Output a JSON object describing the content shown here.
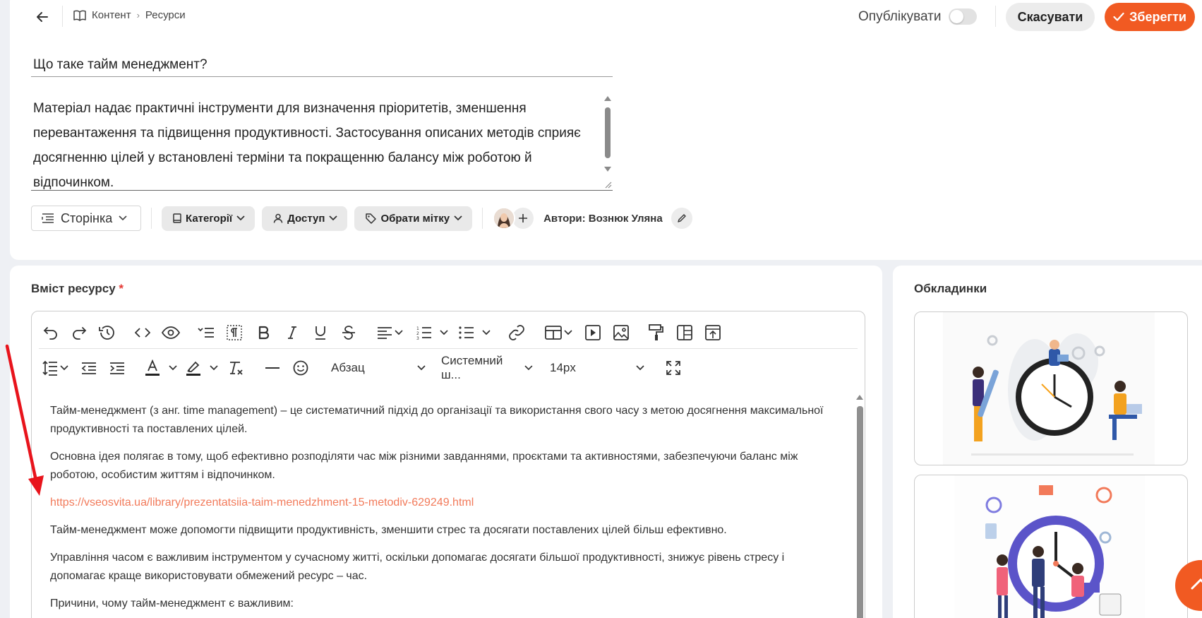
{
  "header": {
    "breadcrumb": [
      "Контент",
      "Ресурси"
    ],
    "publish_label": "Опублікувати",
    "publish_enabled": false,
    "cancel_label": "Скасувати",
    "save_label": "Зберегти"
  },
  "resource": {
    "title": "Що таке тайм менеджмент?",
    "description": "Матеріал надає практичні інструменти для визначення пріоритетів, зменшення перевантаження та підвищення продуктивності. Застосування описаних методів сприяє досягненню цілей у встановлені терміни та покращенню балансу між роботою й відпочинком."
  },
  "meta": {
    "type_label": "Сторінка",
    "categories_label": "Категорії",
    "access_label": "Доступ",
    "tag_label": "Обрати мітку",
    "authors_label": "Автори: Вознюк Уляна"
  },
  "content": {
    "section_label": "Вміст ресурсу",
    "required_mark": "*",
    "toolbar": {
      "paragraph_select": "Абзац",
      "font_select": "Системний ш...",
      "size_select": "14px"
    },
    "paragraphs": [
      "Тайм-менеджмент (з анг. time management) – це систематичний підхід до організації та використання свого часу з метою досягнення максимальної продуктивності та поставлених цілей.",
      "Основна ідея полягає в тому, щоб ефективно розподіляти час між різними завданнями, проєктами та активностями, забезпечуючи баланс між роботою, особистим життям і відпочинком."
    ],
    "link": "https://vseosvita.ua/library/prezentatsiia-taim-menedzhment-15-metodiv-629249.html",
    "paragraphs_after": [
      "Тайм-менеджмент може допомогти підвищити продуктивність, зменшити стрес та досягати поставлених цілей більш ефективно.",
      "Управління часом є важливим інструментом у сучасному житті, оскільки допомагає досягати більшої продуктивності, знижує рівень стресу і допомагає краще використовувати обмежений ресурс – час.",
      "Причини, чому тайм-менеджмент є важливим:"
    ]
  },
  "covers": {
    "label": "Обкладинки"
  },
  "colors": {
    "accent": "#f15a22",
    "link": "#f27a5a",
    "annotation_arrow": "#e8141c"
  }
}
